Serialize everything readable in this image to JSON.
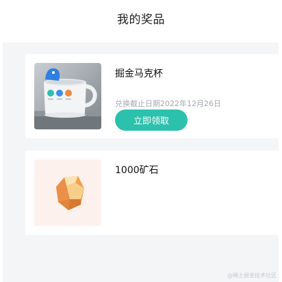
{
  "header": {
    "title": "我的奖品"
  },
  "prizes": [
    {
      "name": "掘金马克杯",
      "expiry": "兑换截止日期2022年12月26日",
      "action_label": "立即领取",
      "icon": "mug-image"
    },
    {
      "name": "1000矿石",
      "icon": "ore-image"
    }
  ],
  "watermark": "@稀土掘金技术社区",
  "colors": {
    "accent": "#2cc1ac",
    "background": "#f4f5f7",
    "subtext": "#a3a8b0"
  }
}
